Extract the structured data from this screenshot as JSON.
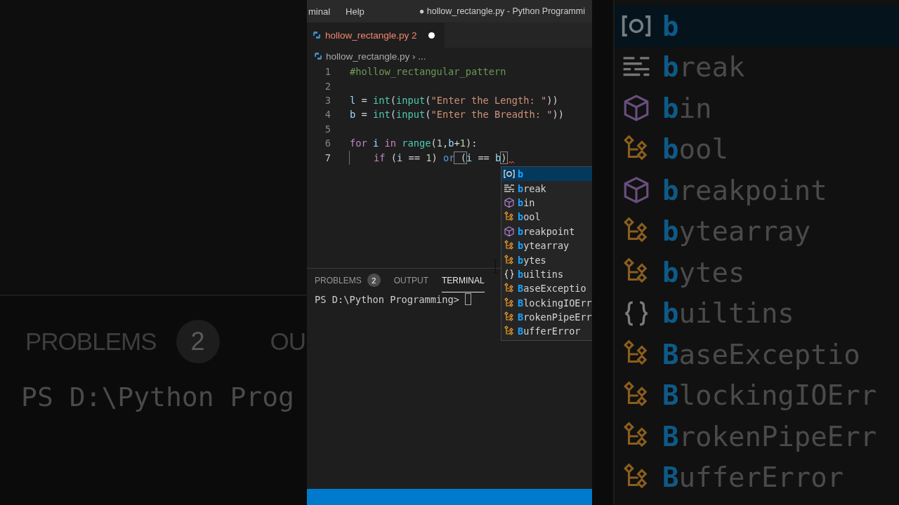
{
  "backdrop_left": {
    "panel_tabs": [
      {
        "label": "PROBLEMS",
        "badge": "2"
      },
      {
        "label": "OU"
      }
    ],
    "terminal_line": "PS D:\\Python Prog"
  },
  "backdrop_right": {
    "suggestions": [
      {
        "match": "b",
        "kind": "variable",
        "selected": true
      },
      {
        "match": "b",
        "rest": "reak",
        "kind": "keyword",
        "selected": false
      },
      {
        "match": "b",
        "rest": "in",
        "kind": "module",
        "selected": false
      },
      {
        "match": "b",
        "rest": "ool",
        "kind": "class",
        "selected": false
      },
      {
        "match": "b",
        "rest": "reakpoint",
        "kind": "module",
        "selected": false
      },
      {
        "match": "b",
        "rest": "ytearray",
        "kind": "class",
        "selected": false
      },
      {
        "match": "b",
        "rest": "ytes",
        "kind": "class",
        "selected": false
      },
      {
        "match": "b",
        "rest": "uiltins",
        "kind": "namespace",
        "selected": false
      },
      {
        "match": "B",
        "rest": "aseExceptio",
        "kind": "class",
        "selected": false
      },
      {
        "match": "B",
        "rest": "lockingIOErr",
        "kind": "class",
        "selected": false
      },
      {
        "match": "B",
        "rest": "rokenPipeErr",
        "kind": "class",
        "selected": false
      },
      {
        "match": "B",
        "rest": "ufferError",
        "kind": "class",
        "selected": false
      }
    ]
  },
  "window": {
    "menu": [
      "minal",
      "Help"
    ],
    "title": "● hollow_rectangle.py - Python Programmi"
  },
  "tabs": [
    {
      "label": "hollow_rectangle.py 2",
      "selected": true,
      "modified": true
    }
  ],
  "breadcrumb": {
    "file": "hollow_rectangle.py",
    "separator": "›",
    "rest": "..."
  },
  "editor": {
    "lines": [
      {
        "number": "1",
        "current": false,
        "tokens": [
          {
            "text": "#hollow_rectangular_pattern",
            "color": "#6a9955"
          }
        ]
      },
      {
        "number": "2",
        "current": false
      },
      {
        "number": "3",
        "current": false,
        "tokens": [
          {
            "text": "l",
            "color": "#9cdcfe"
          },
          {
            "text": " = "
          },
          {
            "text": "int",
            "color": "#4ec9b0"
          },
          {
            "text": "("
          },
          {
            "text": "input",
            "color": "#4ec9b0"
          },
          {
            "text": "("
          },
          {
            "text": "\"Enter the Length: \"",
            "color": "#ce9178"
          },
          {
            "text": "))"
          }
        ]
      },
      {
        "number": "4",
        "current": false,
        "tokens": [
          {
            "text": "b",
            "color": "#9cdcfe"
          },
          {
            "text": " = "
          },
          {
            "text": "int",
            "color": "#4ec9b0"
          },
          {
            "text": "("
          },
          {
            "text": "input",
            "color": "#4ec9b0"
          },
          {
            "text": "("
          },
          {
            "text": "\"Enter the Breadth: \"",
            "color": "#ce9178"
          },
          {
            "text": "))"
          }
        ]
      },
      {
        "number": "5",
        "current": false
      },
      {
        "number": "6",
        "current": false,
        "tokens": [
          {
            "text": "for",
            "color": "#c586c0"
          },
          {
            "text": " i ",
            "color": "#9cdcfe"
          },
          {
            "text": "in",
            "color": "#c586c0"
          },
          {
            "text": " range",
            "color": "#4ec9b0"
          },
          {
            "text": "("
          },
          {
            "text": "1",
            "color": "#b5cea8"
          },
          {
            "text": ","
          },
          {
            "text": "b",
            "color": "#9cdcfe"
          },
          {
            "text": "+"
          },
          {
            "text": "1",
            "color": "#b5cea8"
          },
          {
            "text": "):"
          }
        ]
      },
      {
        "number": "7",
        "current": true,
        "indent": true,
        "error": true,
        "tokens": [
          {
            "text": "if",
            "color": "#c586c0"
          },
          {
            "text": " ("
          },
          {
            "text": "i",
            "color": "#9cdcfe"
          },
          {
            "text": " == "
          },
          {
            "text": "1",
            "color": "#b5cea8"
          },
          {
            "text": ") "
          },
          {
            "text": "or",
            "color": "#569cd6"
          },
          {
            "text": " (",
            "boxed": true
          },
          {
            "text": "i",
            "color": "#9cdcfe"
          },
          {
            "text": " == "
          },
          {
            "text": "b",
            "color": "#9cdcfe"
          },
          {
            "text": ")",
            "boxed": true
          }
        ]
      }
    ]
  },
  "suggestions": [
    {
      "match": "b",
      "kind": "variable",
      "selected": true
    },
    {
      "match": "b",
      "rest": "reak",
      "kind": "keyword",
      "selected": false
    },
    {
      "match": "b",
      "rest": "in",
      "kind": "module",
      "selected": false
    },
    {
      "match": "b",
      "rest": "ool",
      "kind": "class",
      "selected": false
    },
    {
      "match": "b",
      "rest": "reakpoint",
      "kind": "module",
      "selected": false
    },
    {
      "match": "b",
      "rest": "ytearray",
      "kind": "class",
      "selected": false
    },
    {
      "match": "b",
      "rest": "ytes",
      "kind": "class",
      "selected": false
    },
    {
      "match": "b",
      "rest": "uiltins",
      "kind": "namespace",
      "selected": false
    },
    {
      "match": "B",
      "rest": "aseExceptio",
      "kind": "class",
      "selected": false
    },
    {
      "match": "B",
      "rest": "lockingIOErr",
      "kind": "class",
      "selected": false
    },
    {
      "match": "B",
      "rest": "rokenPipeErr",
      "kind": "class",
      "selected": false
    },
    {
      "match": "B",
      "rest": "ufferError",
      "kind": "class",
      "selected": false
    }
  ],
  "panel": {
    "tabs": [
      {
        "label": "PROBLEMS",
        "badge": "2",
        "selected": false
      },
      {
        "label": "OUTPUT",
        "selected": false
      },
      {
        "label": "TERMINAL",
        "selected": true
      }
    ],
    "terminal_prompt": "PS D:\\Python Programming>"
  }
}
